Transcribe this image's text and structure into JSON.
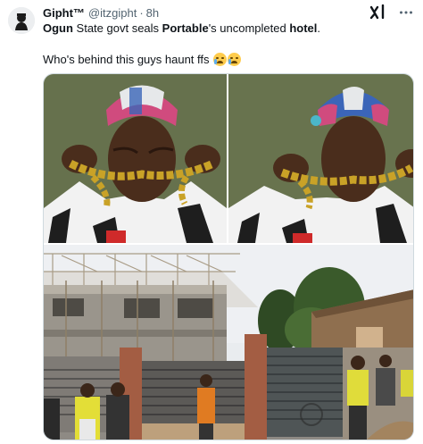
{
  "tweet": {
    "display_name": "Gipht™",
    "handle": "@itzgipht",
    "separator": "·",
    "time": "8h",
    "line1": {
      "w1": "Ogun",
      "t1": " State govt seals ",
      "w2": "Portable",
      "t2": "'s uncompleted ",
      "w3": "hotel",
      "t3": "."
    },
    "line2": "Who's behind this guys haunt ffs"
  },
  "icons": {
    "avatar": "avatar-icon",
    "grok": "xai-grok-icon",
    "more": "more-options-icon",
    "emoji": "loudly-crying-face-emoji"
  },
  "colors": {
    "text": "#0f1419",
    "secondary": "#536471",
    "border": "#cfd9de"
  },
  "media": {
    "photo_count": 3
  }
}
